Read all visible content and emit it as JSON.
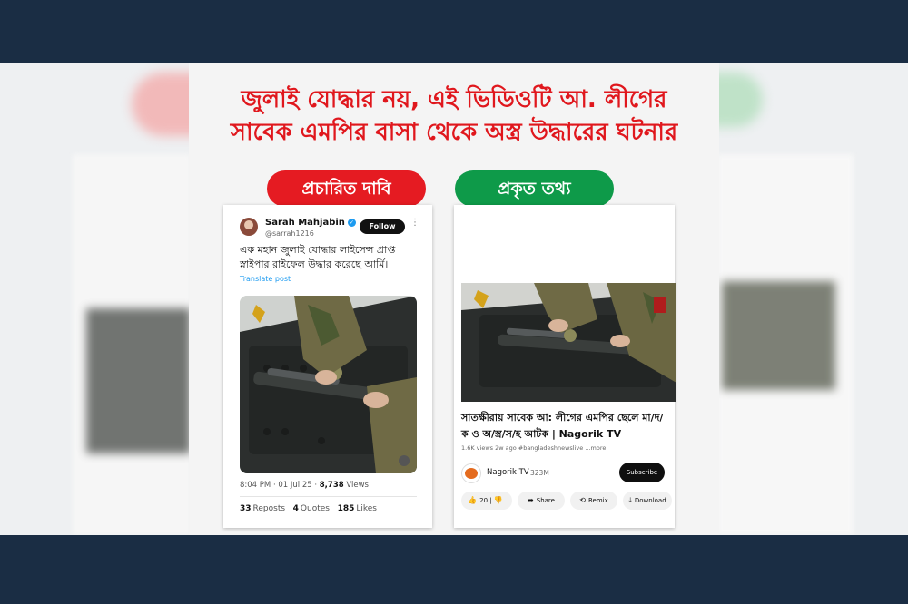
{
  "headline": {
    "line1": "জুলাই যোদ্ধার নয়, এই ভিডিওটি আ. লীগের",
    "line2": "সাবেক এমপির বাসা থেকে অস্ত্র উদ্ধারের ঘটনার"
  },
  "labels": {
    "claim": "প্রচারিত দাবি",
    "fact": "প্রকৃত তথ্য"
  },
  "colors": {
    "navy": "#1a2d44",
    "red": "#e51b22",
    "green": "#0e9a49"
  },
  "tweet": {
    "name": "Sarah Mahjabin",
    "handle": "@sarrah1216",
    "follow_label": "Follow",
    "more_icon": "more-icon",
    "text": "এক মহান জুলাই যোদ্ধার লাইসেন্স প্রাপ্ত স্নাইপার রাইফেল উদ্ধার করেছে আর্মি।",
    "translate_label": "Translate post",
    "time": "8:04 PM · 01 Jul 25 · ",
    "views_count": "8,738",
    "views_label": "Views",
    "reposts_count": "33",
    "reposts_label": "Reposts",
    "quotes_count": "4",
    "quotes_label": "Quotes",
    "likes_count": "185",
    "likes_label": "Likes"
  },
  "youtube": {
    "title": "সাতক্ষীরায় সাবেক আ: লীগের এমপির ছেলে মা/দ/ক ও অ/স্ত্র/স/হ আটক | Nagorik TV",
    "meta": "1.6K views  2w ago  #bangladeshnewslive  ...more",
    "channel": "Nagorik TV",
    "subs": "323M",
    "subscribe_label": "Subscribe",
    "like_count": "20",
    "share_label": "Share",
    "remix_label": "Remix",
    "download_label": "Download"
  }
}
